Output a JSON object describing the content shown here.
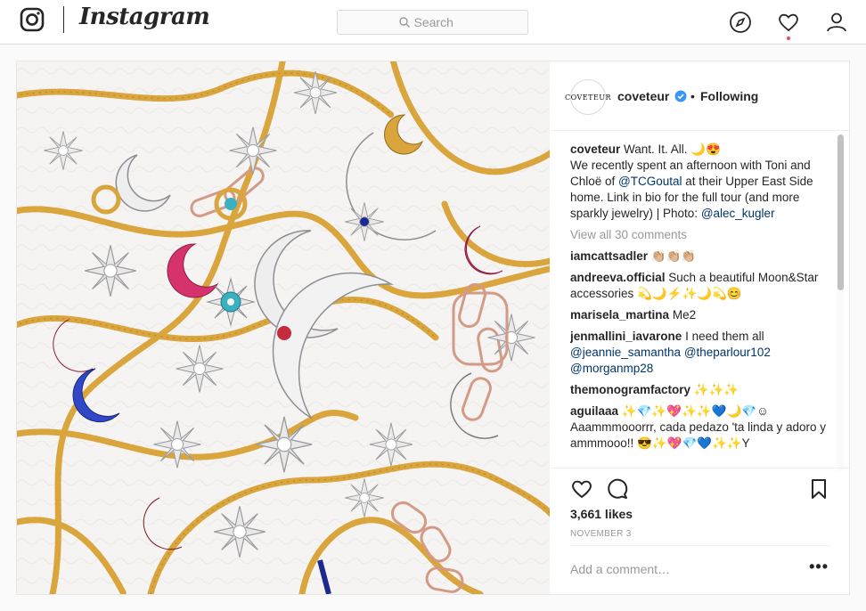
{
  "brand": {
    "wordmark": "Instagram"
  },
  "search": {
    "placeholder": "Search"
  },
  "post": {
    "author": {
      "handle": "coveteur",
      "avatar_text": "COVETEUR",
      "follow_sep": "•",
      "follow_state": "Following"
    },
    "caption": {
      "user": "coveteur",
      "line1": " Want. It. All. 🌙😍",
      "line2": "We recently spent an afternoon with Toni and Chloë of ",
      "mention1": "@TCGoutal",
      "line3": " at their Upper East Side home. Link in bio for the full tour (and more sparkly jewelry) | Photo: ",
      "mention2": "@alec_kugler"
    },
    "view_all": "View all 30 comments",
    "comments": [
      {
        "user": "iamcattsadler",
        "text": " 👏🏼👏🏼👏🏼"
      },
      {
        "user": "andreeva.official",
        "text": " Such a beautiful Moon&Star accessories 💫🌙⚡✨🌙💫😊"
      },
      {
        "user": "marisela_martina",
        "text": " Me2"
      },
      {
        "user": "jenmallini_iavarone",
        "text": " I need them all ",
        "mentions": [
          "@jeannie_samantha",
          "@theparlour102",
          "@morganmp28"
        ]
      },
      {
        "user": "themonogramfactory",
        "text": " ✨✨✨"
      },
      {
        "user": "aguilaaa",
        "text": " ✨💎✨💖✨✨💙🌙💎☺ Aaammmooorrr, cada pedazo 'ta linda y adoro y ammmooo!! 😎✨💖💎💙✨✨Y"
      }
    ],
    "likes": "3,661 likes",
    "date": "NOVEMBER 3",
    "add_comment_placeholder": "Add a comment…",
    "more_label": "•••"
  },
  "colors": {
    "border": "#dbdbdb",
    "link": "#003569",
    "verified": "#3897f0",
    "notification": "#ed4956",
    "gold": "#d9a53c",
    "rose_gold": "#d49a86"
  },
  "icons": [
    "instagram-logo-icon",
    "search-icon",
    "explore-compass-icon",
    "heart-icon",
    "profile-icon",
    "verified-badge-icon",
    "like-heart-icon",
    "comment-bubble-icon",
    "bookmark-icon"
  ]
}
